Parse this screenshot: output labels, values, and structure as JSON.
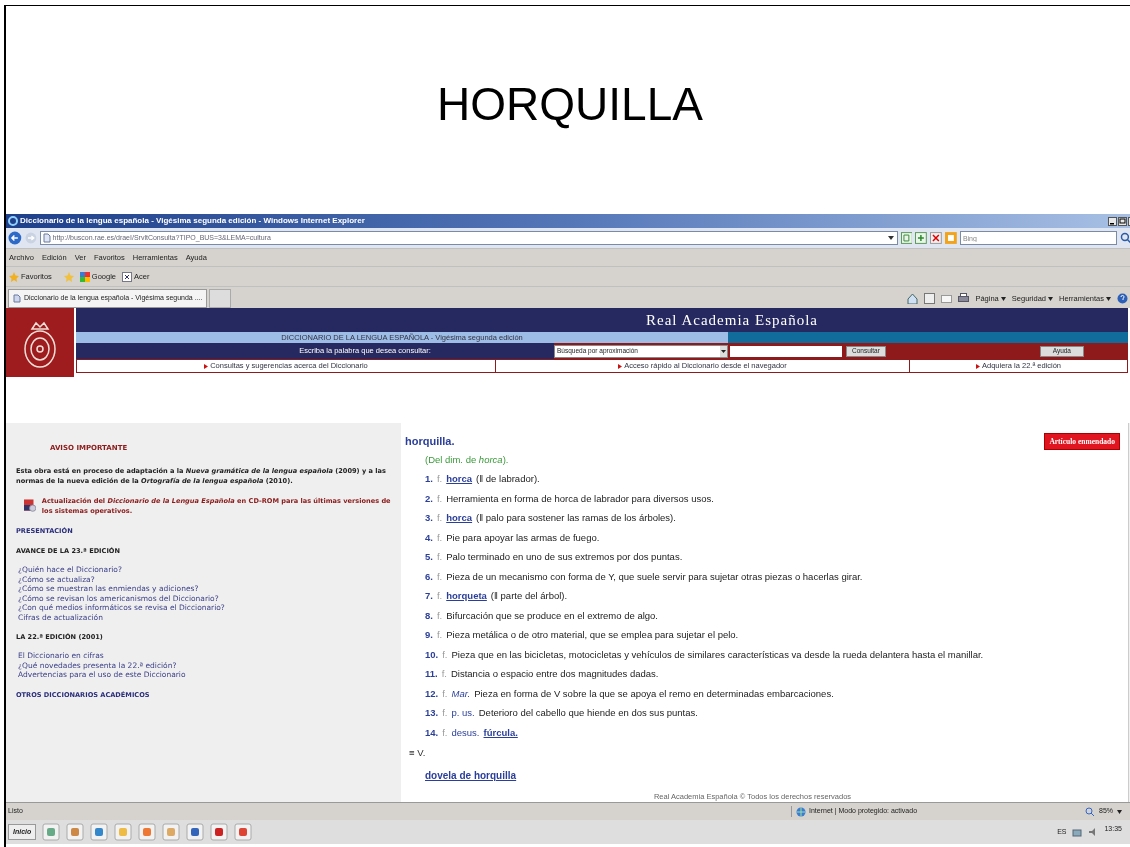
{
  "slide": {
    "title": "HORQUILLA"
  },
  "window": {
    "title": "Diccionario de la lengua española - Vigésima segunda edición - Windows Internet Explorer"
  },
  "address_bar": {
    "url": "http://buscon.rae.es/draeI/SrvltConsulta?TIPO_BUS=3&LEMA=cultura",
    "search_placeholder": "Bing"
  },
  "menu": [
    "Archivo",
    "Edición",
    "Ver",
    "Favoritos",
    "Herramientas",
    "Ayuda"
  ],
  "favorites_bar": [
    {
      "label": "Favoritos",
      "kind": "star"
    },
    {
      "label": "Google",
      "kind": "google"
    },
    {
      "label": "Acer",
      "kind": "page"
    }
  ],
  "tabs": [
    {
      "label": "Diccionario de la lengua española - Vigésima segunda ....",
      "selected": true
    }
  ],
  "command_bar": [
    "Página",
    "Seguridad",
    "Herramientas"
  ],
  "site_header": {
    "title": "Real Academia Española",
    "subtitle": "DICCIONARIO DE LA LENGUA ESPAÑOLA - Vigésima segunda edición",
    "search_label": "Escriba la palabra que desea consultar:",
    "search_mode": "Búsqueda por aproximación",
    "buttons": [
      "Consultar",
      "Ayuda"
    ],
    "links": [
      "Consultas y sugerencias acerca del Diccionario",
      "Acceso rápido al Diccionario desde el navegador",
      "Adquiera la 22.ª edición"
    ]
  },
  "sidebar": {
    "notice_title": "AVISO IMPORTANTE",
    "notice_text": "Esta obra está en proceso de adaptación a la *Nueva gramática de la lengua española* (2009) y a las normas de la nueva edición de la *Ortografía de la lengua española* (2010).",
    "cd_rom_link": "Actualización del *Diccionario de la Lengua Española* en CD-ROM para las últimas versiones de los sistemas operativos.",
    "sections": [
      {
        "title": "PRESENTACIÓN",
        "kind": "link"
      },
      {
        "title": "AVANCE DE LA 23.ª EDICIÓN",
        "kind": "heading",
        "links": [
          "¿Quién hace el Diccionario?",
          "¿Cómo se actualiza?",
          "¿Cómo se muestran las enmiendas y adiciones?",
          "¿Cómo se revisan los americanismos del Diccionario?",
          "¿Con qué medios informáticos se revisa el Diccionario?",
          "Cifras de actualización"
        ]
      },
      {
        "title": "LA 22.ª EDICIÓN (2001)",
        "kind": "heading",
        "links": [
          "El Diccionario en cifras",
          "¿Qué novedades presenta la 22.ª edición?",
          "Advertencias para el uso de este Diccionario"
        ]
      },
      {
        "title": "OTROS DICCIONARIOS ACADÉMICOS",
        "kind": "link"
      }
    ]
  },
  "entry": {
    "headword": "horquilla.",
    "amended_badge": "Artículo enmendado",
    "etymology": "(Del dim. de *horca*).",
    "senses": [
      {
        "number": "1.",
        "category": "f.",
        "link": "horca",
        "text": "(‖ de labrador)."
      },
      {
        "number": "2.",
        "category": "f.",
        "text": "Herramienta en forma de horca de labrador para diversos usos."
      },
      {
        "number": "3.",
        "category": "f.",
        "link": "horca",
        "text": "(‖ palo para sostener las ramas de los árboles)."
      },
      {
        "number": "4.",
        "category": "f.",
        "text": "Pie para apoyar las armas de fuego."
      },
      {
        "number": "5.",
        "category": "f.",
        "text": "Palo terminado en uno de sus extremos por dos puntas."
      },
      {
        "number": "6.",
        "category": "f.",
        "text": "Pieza de un mecanismo con forma de Y, que suele servir para sujetar otras piezas o hacerlas girar."
      },
      {
        "number": "7.",
        "category": "f.",
        "link": "horqueta",
        "text": "(‖ parte del árbol)."
      },
      {
        "number": "8.",
        "category": "f.",
        "text": "Bifurcación que se produce en el extremo de algo."
      },
      {
        "number": "9.",
        "category": "f.",
        "text": "Pieza metálica o de otro material, que se emplea para sujetar el pelo."
      },
      {
        "number": "10.",
        "category": "f.",
        "text": "Pieza que en las bicicletas, motocicletas y vehículos de similares características va desde la rueda delantera hasta el manillar."
      },
      {
        "number": "11.",
        "category": "f.",
        "text": "Distancia o espacio entre dos magnitudes dadas."
      },
      {
        "number": "12.",
        "category": "f.",
        "usage": "Mar.",
        "usage_italic": true,
        "text": "Pieza en forma de V sobre la que se apoya el remo en determinadas embarcaciones."
      },
      {
        "number": "13.",
        "category": "f.",
        "usage": "p. us.",
        "usage_italic": false,
        "text": "Deterioro del cabello que hiende en dos sus puntas."
      },
      {
        "number": "14.",
        "category": "f.",
        "usage": "desus.",
        "usage_italic": false,
        "link": "fúrcula."
      }
    ],
    "see_mark": "≡ V.",
    "compound_link": "dovela de horquilla",
    "footer": "Real Academia Española © Todos los derechos reservados"
  },
  "status_bar": {
    "status": "Listo",
    "zone": "Internet | Modo protegido: activado",
    "zoom": "85%"
  },
  "taskbar": {
    "start": "Inicio",
    "language": "ES",
    "time": "13:35"
  }
}
